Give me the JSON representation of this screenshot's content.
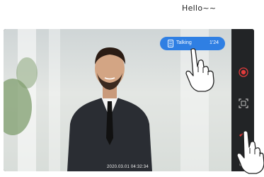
{
  "caption": "Hello~~",
  "talk_button": {
    "label": "Talking",
    "timer": "1'24"
  },
  "timestamp": "2020.03.01  04:32:34",
  "side_controls": [
    "record-icon",
    "snapshot-icon",
    "hangup-icon",
    "lock-icon"
  ],
  "colors": {
    "talk_pill": "#2f7fe3",
    "record": "#e23b3b",
    "hangup": "#d93434",
    "panel": "#222426"
  }
}
